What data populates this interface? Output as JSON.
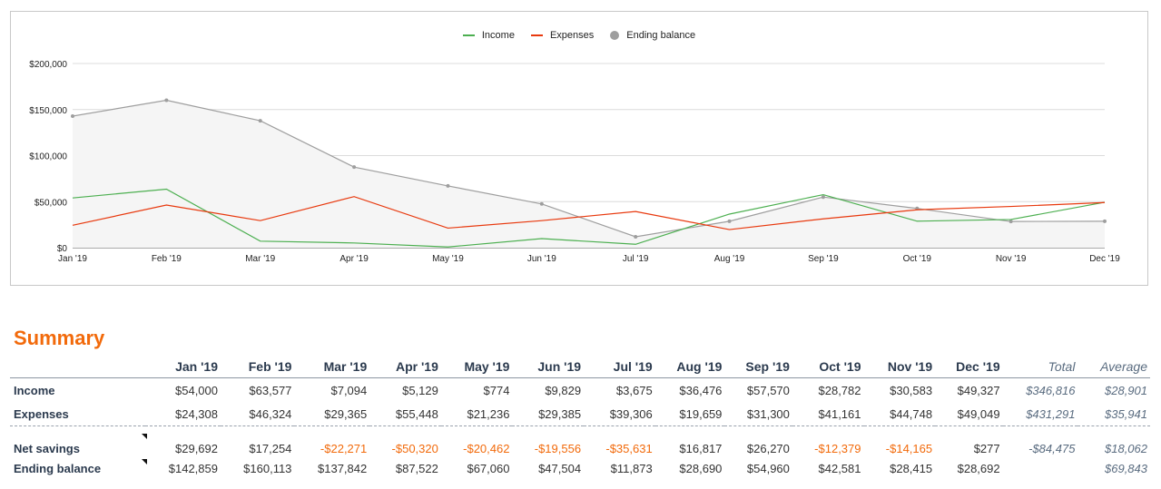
{
  "chart_data": {
    "type": "line",
    "categories": [
      "Jan '19",
      "Feb '19",
      "Mar '19",
      "Apr '19",
      "May '19",
      "Jun '19",
      "Jul '19",
      "Aug '19",
      "Sep '19",
      "Oct '19",
      "Nov '19",
      "Dec '19"
    ],
    "series": [
      {
        "name": "Income",
        "type": "line",
        "color": "#4caf50",
        "values": [
          54000,
          63577,
          7094,
          5129,
          774,
          9829,
          3675,
          36476,
          57570,
          28782,
          30583,
          49327
        ]
      },
      {
        "name": "Expenses",
        "type": "line",
        "color": "#e8390e",
        "values": [
          24308,
          46324,
          29365,
          55448,
          21236,
          29385,
          39306,
          19659,
          31300,
          41161,
          44748,
          49049
        ]
      },
      {
        "name": "Ending balance",
        "type": "area",
        "color": "#9e9e9e",
        "values": [
          142859,
          160113,
          137842,
          87522,
          67060,
          47504,
          11873,
          28690,
          54960,
          42581,
          28415,
          28692
        ]
      }
    ],
    "y_ticks": [
      "$0",
      "$50,000",
      "$100,000",
      "$150,000",
      "$200,000"
    ],
    "y_tick_values": [
      0,
      50000,
      100000,
      150000,
      200000
    ],
    "ylim": [
      0,
      200000
    ],
    "grid": true,
    "legend": "top-center"
  },
  "summary": {
    "title": "Summary",
    "columns": [
      "Jan '19",
      "Feb '19",
      "Mar '19",
      "Apr '19",
      "May '19",
      "Jun '19",
      "Jul '19",
      "Aug '19",
      "Sep '19",
      "Oct '19",
      "Nov '19",
      "Dec '19"
    ],
    "total_label": "Total",
    "average_label": "Average",
    "rows": [
      {
        "label": "Income",
        "values": [
          "$54,000",
          "$63,577",
          "$7,094",
          "$5,129",
          "$774",
          "$9,829",
          "$3,675",
          "$36,476",
          "$57,570",
          "$28,782",
          "$30,583",
          "$49,327"
        ],
        "total": "$346,816",
        "average": "$28,901"
      },
      {
        "label": "Expenses",
        "values": [
          "$24,308",
          "$46,324",
          "$29,365",
          "$55,448",
          "$21,236",
          "$29,385",
          "$39,306",
          "$19,659",
          "$31,300",
          "$41,161",
          "$44,748",
          "$49,049"
        ],
        "total": "$431,291",
        "average": "$35,941"
      },
      {
        "label": "Net savings",
        "values": [
          "$29,692",
          "$17,254",
          "-$22,271",
          "-$50,320",
          "-$20,462",
          "-$19,556",
          "-$35,631",
          "$16,817",
          "$26,270",
          "-$12,379",
          "-$14,165",
          "$277"
        ],
        "total": "-$84,475",
        "average": "$18,062"
      },
      {
        "label": "Ending balance",
        "values": [
          "$142,859",
          "$160,113",
          "$137,842",
          "$87,522",
          "$67,060",
          "$47,504",
          "$11,873",
          "$28,690",
          "$54,960",
          "$42,581",
          "$28,415",
          "$28,692"
        ],
        "total": "",
        "average": "$69,843"
      }
    ]
  }
}
